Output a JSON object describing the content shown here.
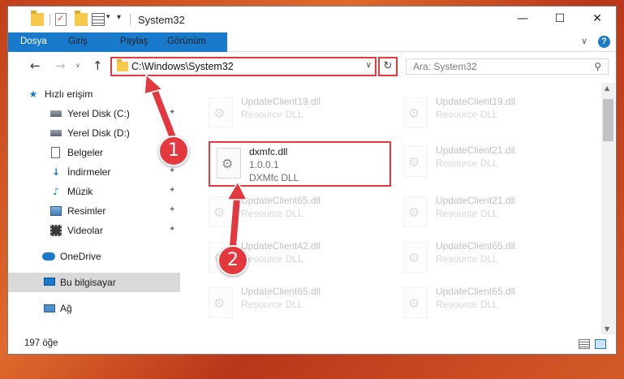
{
  "window": {
    "title": "System32",
    "quick_access_caret": "▾",
    "quick_access_down": "▾",
    "controls": {
      "minimize": "—",
      "maximize": "☐",
      "close": "✕"
    }
  },
  "ribbon": {
    "tabs": [
      "Dosya",
      "Giriş",
      "Paylaş",
      "Görünüm"
    ],
    "collapse_glyph": "∨",
    "help_glyph": "?"
  },
  "nav": {
    "back_glyph": "←",
    "forward_glyph": "→",
    "history_glyph": "∨",
    "up_glyph": "↑",
    "address": "C:\\Windows\\System32",
    "address_dropdown_glyph": "∨",
    "refresh_glyph": "↻",
    "search_placeholder": "Ara: System32",
    "search_glyph": "⚲"
  },
  "sidebar": {
    "items": [
      {
        "label": "Hızlı erişim",
        "icon": "star-icon",
        "glyph": "★"
      },
      {
        "label": "Yerel Disk (C:)",
        "icon": "disk-icon"
      },
      {
        "label": "Yerel Disk (D:)",
        "icon": "disk-icon"
      },
      {
        "label": "Belgeler",
        "icon": "document-icon"
      },
      {
        "label": "İndirmeler",
        "icon": "download-icon",
        "glyph": "↓"
      },
      {
        "label": "Müzik",
        "icon": "music-icon",
        "glyph": "♪"
      },
      {
        "label": "Resimler",
        "icon": "pictures-icon"
      },
      {
        "label": "Videolar",
        "icon": "videos-icon"
      },
      {
        "label": "OneDrive",
        "icon": "cloud-icon"
      },
      {
        "label": "Bu bilgisayar",
        "icon": "computer-icon",
        "selected": true
      },
      {
        "label": "Ağ",
        "icon": "network-icon"
      }
    ],
    "pin_glyph": "✦"
  },
  "files": {
    "left": [
      {
        "name": "UpdateClient19.dll",
        "desc": "Resource DLL"
      },
      {
        "name": "dxmfc.dll",
        "version": "1.0.0.1",
        "desc": "DXMfc DLL",
        "highlighted": true
      },
      {
        "name": "UpdateClient65.dll",
        "desc": "Resource DLL"
      },
      {
        "name": "UpdateClient42.dll",
        "desc": "Resource DLL"
      },
      {
        "name": "UpdateClient65.dll",
        "desc": "Resource DLL"
      }
    ],
    "right": [
      {
        "name": "UpdateClient19.dll",
        "desc": "Resource DLL"
      },
      {
        "name": "UpdateClient21.dll",
        "desc": "Resource DLL"
      },
      {
        "name": "UpdateClient21.dll",
        "desc": "Resource DLL"
      },
      {
        "name": "UpdateClient65.dll",
        "desc": "Resource DLL"
      },
      {
        "name": "UpdateClient65.dll",
        "desc": "Resource DLL"
      }
    ]
  },
  "scrollbar": {
    "up_glyph": "▲",
    "down_glyph": "▼"
  },
  "status": {
    "item_count": "197 öğe"
  },
  "callouts": {
    "step1": "1",
    "step2": "2"
  },
  "colors": {
    "accent": "#1979ca",
    "highlight": "#e4383f"
  }
}
